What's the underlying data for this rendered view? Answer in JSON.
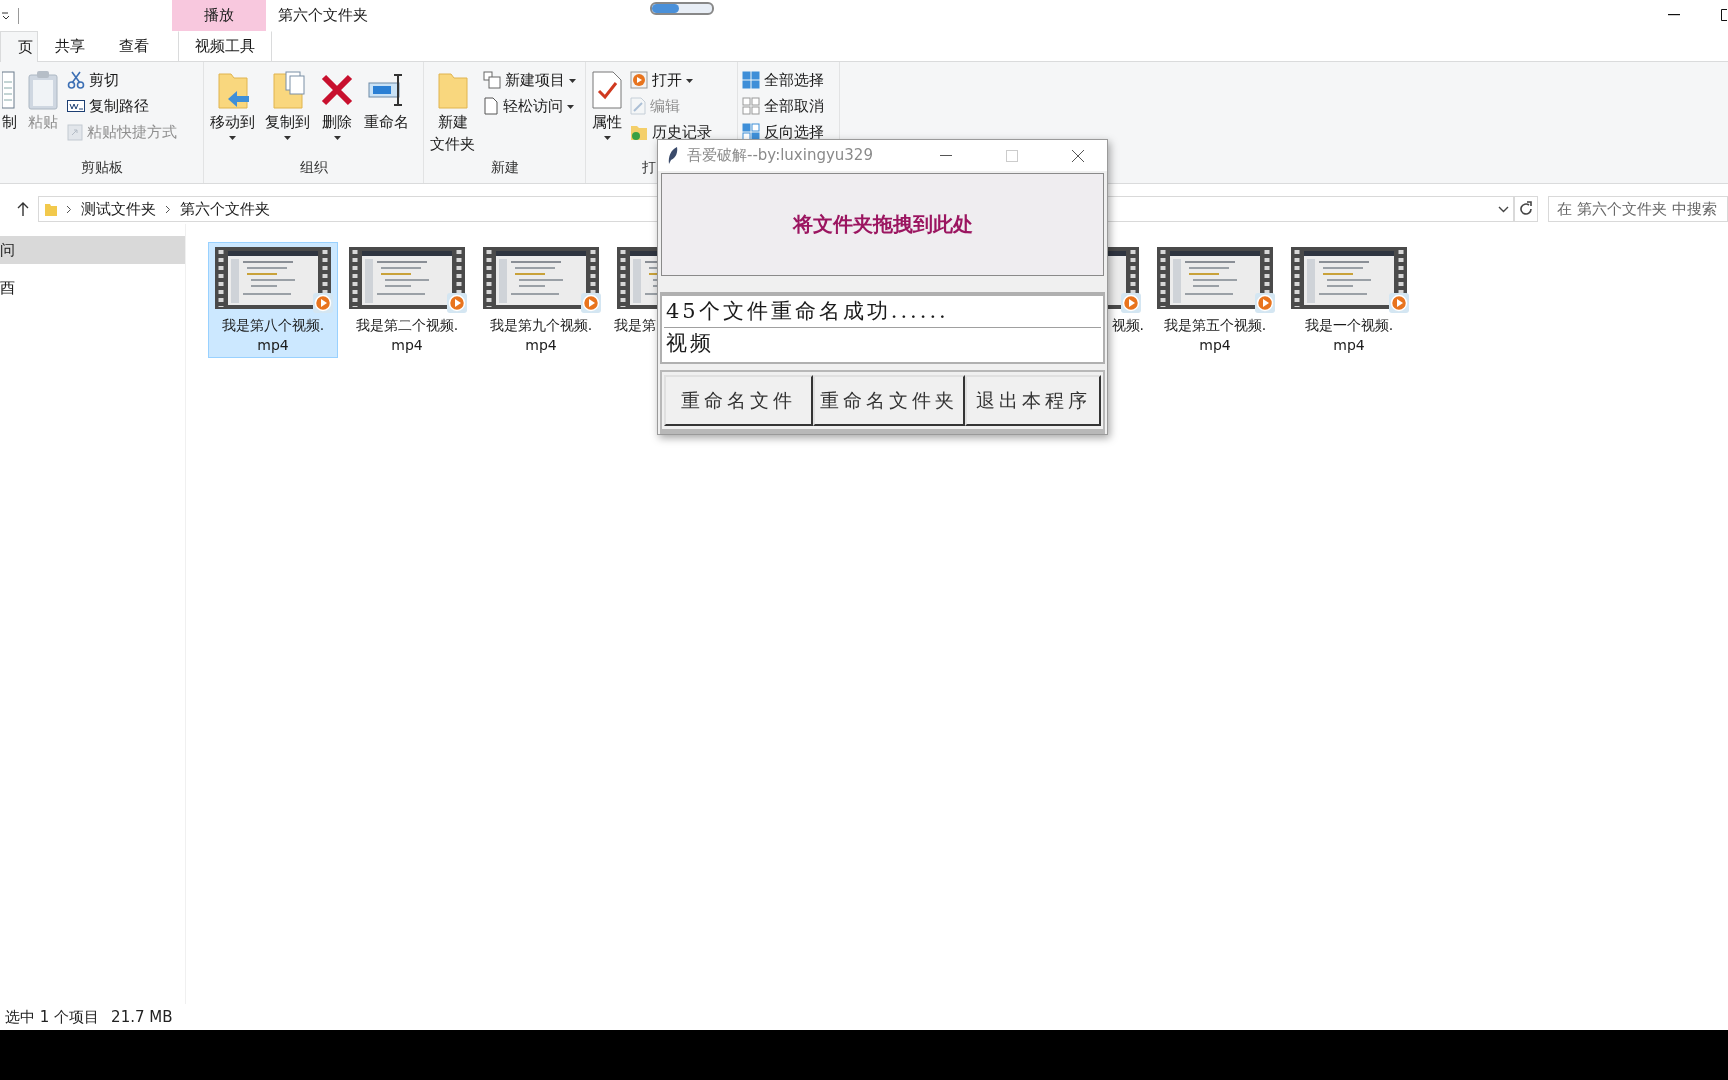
{
  "titlebar": {
    "context_tab": "播放",
    "title": "第六个文件夹"
  },
  "tabs": [
    {
      "label": "页",
      "selected": true
    },
    {
      "label": "共享",
      "selected": false
    },
    {
      "label": "查看",
      "selected": false
    },
    {
      "label": "视频工具",
      "selected": false
    }
  ],
  "ribbon": [
    {
      "label": "剪贴板",
      "items": [
        {
          "label": "制",
          "kind": "large",
          "disabled": false
        },
        {
          "label": "粘贴",
          "kind": "large",
          "disabled": true
        },
        {
          "label": "剪切",
          "kind": "small",
          "disabled": false
        },
        {
          "label": "复制路径",
          "kind": "small",
          "disabled": false
        },
        {
          "label": "粘贴快捷方式",
          "kind": "small",
          "disabled": true
        }
      ]
    },
    {
      "label": "组织",
      "items": [
        {
          "label": "移动到",
          "kind": "large",
          "disabled": false
        },
        {
          "label": "复制到",
          "kind": "large",
          "disabled": false
        },
        {
          "label": "删除",
          "kind": "large",
          "disabled": false
        },
        {
          "label": "重命名",
          "kind": "large",
          "disabled": false
        }
      ]
    },
    {
      "label": "新建",
      "items": [
        {
          "label": "新建",
          "label_line2": "文件夹",
          "kind": "large",
          "disabled": false
        },
        {
          "label": "新建项目",
          "kind": "small",
          "disabled": false
        },
        {
          "label": "轻松访问",
          "kind": "small",
          "disabled": false
        }
      ]
    },
    {
      "label": "打",
      "items": [
        {
          "label": "属性",
          "kind": "large",
          "disabled": false
        },
        {
          "label": "打开",
          "kind": "small",
          "disabled": false
        },
        {
          "label": "编辑",
          "kind": "small",
          "disabled": true
        },
        {
          "label": "历史记录",
          "kind": "small",
          "disabled": false
        }
      ]
    },
    {
      "items": [
        {
          "label": "全部选择",
          "kind": "small",
          "disabled": false
        },
        {
          "label": "全部取消",
          "kind": "small",
          "disabled": false
        },
        {
          "label": "反向选择",
          "kind": "small",
          "disabled": false
        }
      ]
    }
  ],
  "address": {
    "crumbs": [
      "测试文件夹",
      "第六个文件夹"
    ],
    "search_placeholder": "在 第六个文件夹 中搜索"
  },
  "sidebar": [
    {
      "label": "问",
      "selected": true
    },
    {
      "label": "酉",
      "selected": false
    }
  ],
  "files": [
    {
      "name": "我是第八个视频.\nmp4",
      "selected": true
    },
    {
      "name": "我是第二个视频.\nmp4",
      "selected": false
    },
    {
      "name": "我是第九个视频.\nmp4",
      "selected": false
    },
    {
      "name": "我是第",
      "selected": false
    },
    {
      "name": "视频.",
      "selected": false
    },
    {
      "name": "我是第五个视频.\nmp4",
      "selected": false
    },
    {
      "name": "我是一个视频.\nmp4",
      "selected": false
    }
  ],
  "status": {
    "selection": "选中 1 个项目",
    "size": "21.7 MB"
  },
  "dialog": {
    "title": "吾爱破解--by:luxingyu329",
    "drop_label": "将文件夹拖拽到此处",
    "log": [
      "45个文件重命名成功......",
      "视频"
    ],
    "buttons": [
      "重命名文件",
      "重命名文件夹",
      "退出本程序"
    ]
  }
}
